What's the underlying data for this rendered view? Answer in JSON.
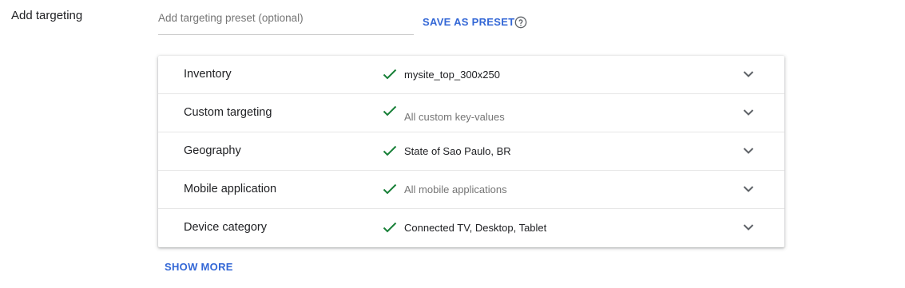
{
  "section": {
    "label": "Add targeting"
  },
  "preset": {
    "placeholder": "Add targeting preset (optional)",
    "value": "",
    "save_label": "SAVE AS PRESET",
    "help_icon": "help-circle-icon"
  },
  "targeting": {
    "rows": [
      {
        "label": "Inventory",
        "value": "mysite_top_300x250",
        "muted": false,
        "status_icon": "check-icon",
        "expand_icon": "chevron-down-icon"
      },
      {
        "label": "Custom targeting",
        "value": "All custom key-values",
        "muted": true,
        "status_icon": "check-icon",
        "expand_icon": "chevron-down-icon"
      },
      {
        "label": "Geography",
        "value": "State of Sao Paulo, BR",
        "muted": false,
        "status_icon": "check-icon",
        "expand_icon": "chevron-down-icon"
      },
      {
        "label": "Mobile application",
        "value": "All mobile applications",
        "muted": true,
        "status_icon": "check-icon",
        "expand_icon": "chevron-down-icon"
      },
      {
        "label": "Device category",
        "value": "Connected TV, Desktop, Tablet",
        "muted": false,
        "status_icon": "check-icon",
        "expand_icon": "chevron-down-icon"
      }
    ]
  },
  "footer": {
    "show_more_label": "SHOW MORE"
  },
  "colors": {
    "accent": "#3367d6",
    "check": "#188038",
    "muted_text": "#757575"
  }
}
